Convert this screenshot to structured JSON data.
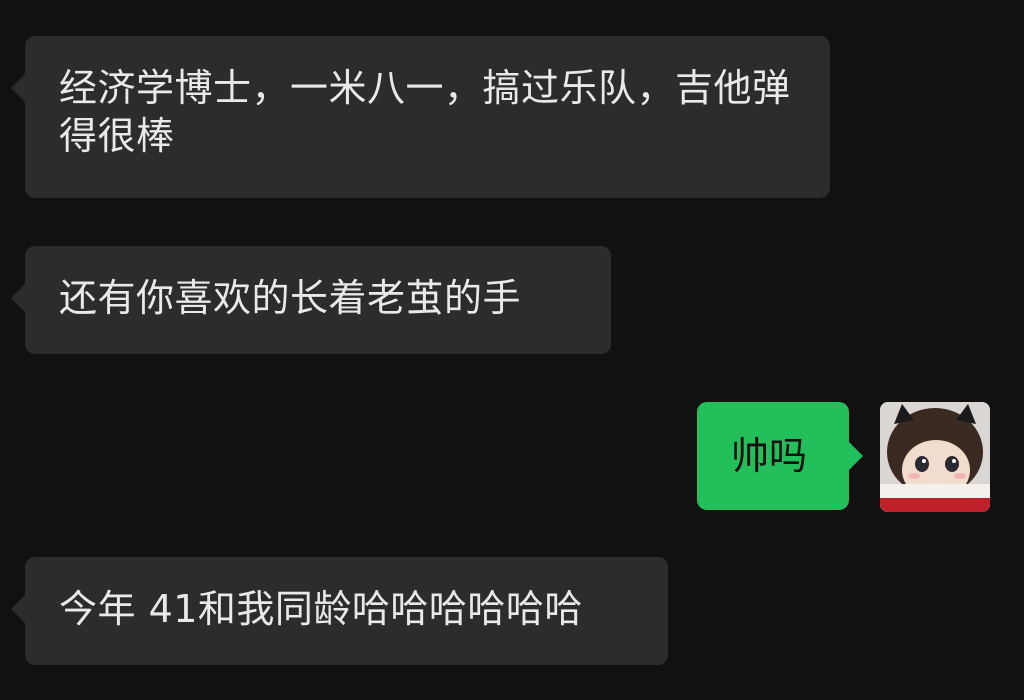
{
  "chat": {
    "messages": [
      {
        "side": "in",
        "text": "经济学博士，一米八一，搞过乐队，吉他弹得很棒"
      },
      {
        "side": "in",
        "text": "还有你喜欢的长着老茧的手"
      },
      {
        "side": "out",
        "text": "帅吗"
      },
      {
        "side": "in",
        "text": "今年 41和我同龄哈哈哈哈哈哈"
      }
    ]
  },
  "colors": {
    "background": "#111111",
    "incoming_bubble": "#2c2c2c",
    "outgoing_bubble": "#22bf5a"
  },
  "icons": {
    "avatar": "user-avatar-image"
  }
}
